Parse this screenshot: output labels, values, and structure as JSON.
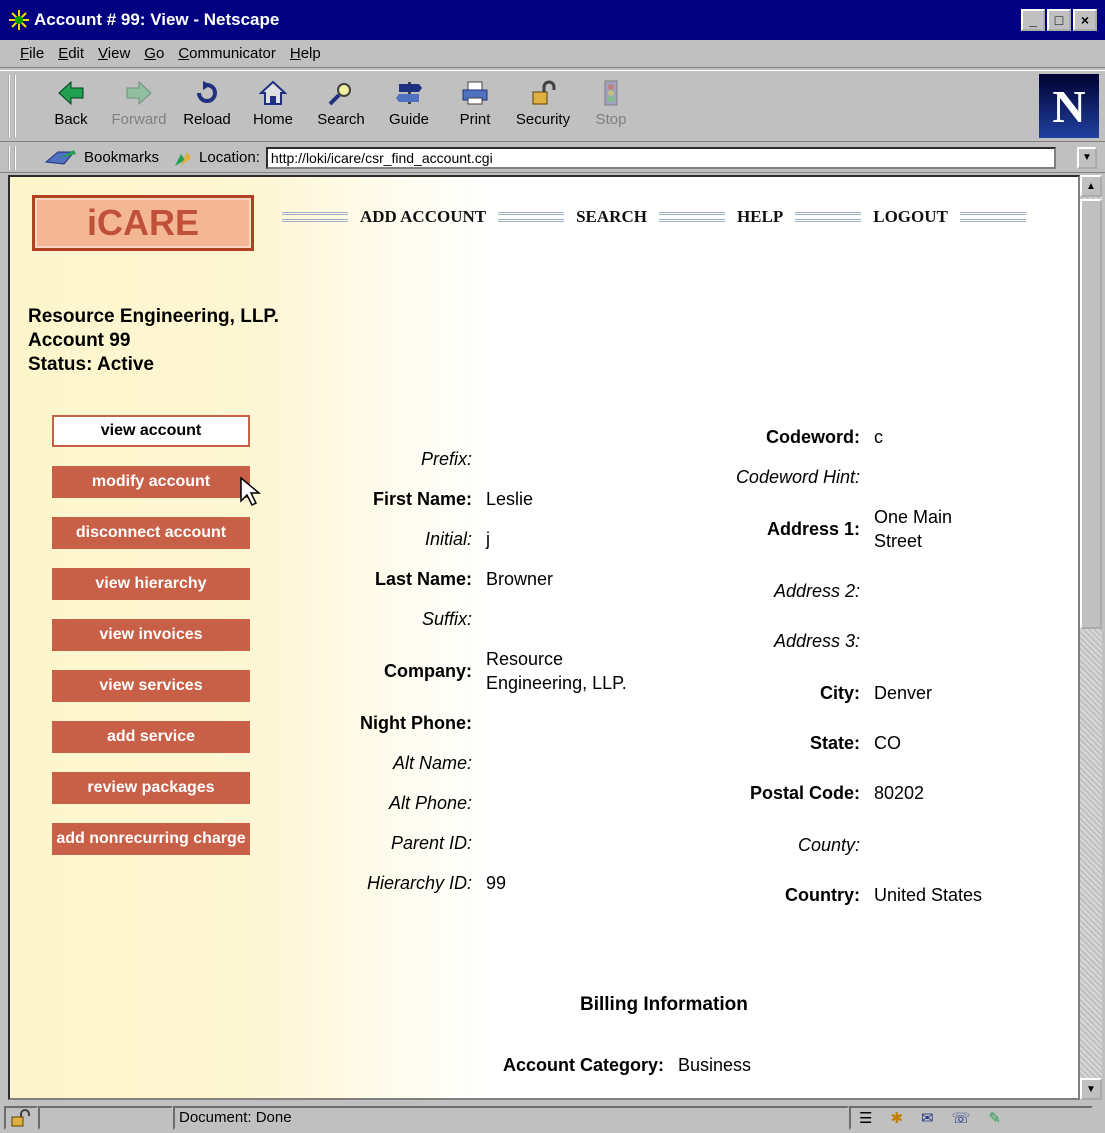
{
  "window": {
    "title": "Account # 99: View - Netscape"
  },
  "menu": [
    {
      "pre": "",
      "u": "F",
      "post": "ile"
    },
    {
      "pre": "",
      "u": "E",
      "post": "dit"
    },
    {
      "pre": "",
      "u": "V",
      "post": "iew"
    },
    {
      "pre": "",
      "u": "G",
      "post": "o"
    },
    {
      "pre": "",
      "u": "C",
      "post": "ommunicator"
    },
    {
      "pre": "",
      "u": "H",
      "post": "elp"
    }
  ],
  "toolbar": {
    "back": "Back",
    "forward": "Forward",
    "reload": "Reload",
    "home": "Home",
    "search": "Search",
    "guide": "Guide",
    "print": "Print",
    "security": "Security",
    "stop": "Stop"
  },
  "location": {
    "bookmarks_label": "Bookmarks",
    "location_label": "Location:",
    "url": "http://loki/icare/csr_find_account.cgi"
  },
  "page": {
    "logo": "iCARE",
    "nav": {
      "add_account": "ADD ACCOUNT",
      "search": "SEARCH",
      "help": "HELP",
      "logout": "LOGOUT"
    },
    "header": {
      "company": "Resource Engineering, LLP.",
      "account": "Account 99",
      "status": "Status: Active"
    },
    "side_buttons": [
      "view account",
      "modify account",
      "disconnect account",
      "view hierarchy",
      "view invoices",
      "view services",
      "add service",
      "review packages",
      "add nonrecurring charge"
    ],
    "left_fields": [
      {
        "label": "Prefix:",
        "value": "",
        "style": "i"
      },
      {
        "label": "First Name:",
        "value": "Leslie",
        "style": "b"
      },
      {
        "label": "Initial:",
        "value": "j",
        "style": "i"
      },
      {
        "label": "Last Name:",
        "value": "Browner",
        "style": "b"
      },
      {
        "label": "Suffix:",
        "value": "",
        "style": "i"
      },
      {
        "label": "Company:",
        "value": "Resource Engineering, LLP.",
        "style": "b"
      },
      {
        "label": "Night Phone:",
        "value": "",
        "style": "b"
      },
      {
        "label": "Alt Name:",
        "value": "",
        "style": "i"
      },
      {
        "label": "Alt Phone:",
        "value": "",
        "style": "i"
      },
      {
        "label": "Parent ID:",
        "value": "",
        "style": "i"
      },
      {
        "label": "Hierarchy ID:",
        "value": "99",
        "style": "i"
      }
    ],
    "right_fields": [
      {
        "label": "Codeword:",
        "value": "c",
        "style": "b"
      },
      {
        "label": "Codeword Hint:",
        "value": "",
        "style": "i"
      },
      {
        "label": "Address 1:",
        "value": "One Main Street",
        "style": "b"
      },
      {
        "label": "Address 2:",
        "value": "",
        "style": "i"
      },
      {
        "label": "Address 3:",
        "value": "",
        "style": "i"
      },
      {
        "label": "City:",
        "value": "Denver",
        "style": "b"
      },
      {
        "label": "State:",
        "value": "CO",
        "style": "b"
      },
      {
        "label": "Postal Code:",
        "value": "80202",
        "style": "b"
      },
      {
        "label": "County:",
        "value": "",
        "style": "i"
      },
      {
        "label": "Country:",
        "value": "United States",
        "style": "b"
      }
    ],
    "billing": {
      "title": "Billing Information",
      "category_label": "Account Category:",
      "category_value": "Business"
    }
  },
  "status": {
    "text": "Document: Done"
  }
}
